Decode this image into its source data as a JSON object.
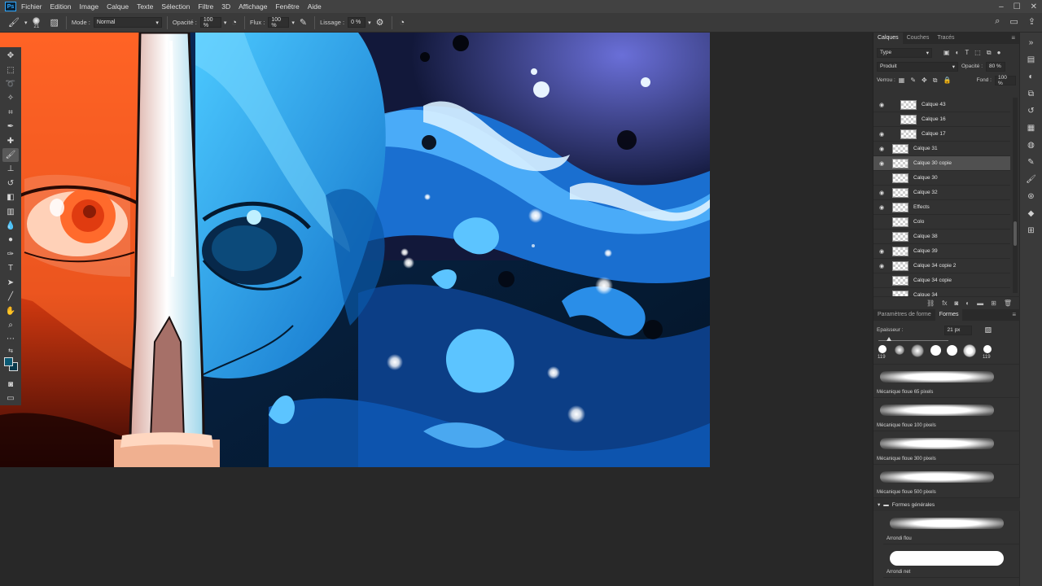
{
  "app": {
    "logo": "Ps"
  },
  "menubar": {
    "items": [
      "Fichier",
      "Edition",
      "Image",
      "Calque",
      "Texte",
      "Sélection",
      "Filtre",
      "3D",
      "Affichage",
      "Fenêtre",
      "Aide"
    ]
  },
  "options": {
    "brush_size": "21",
    "mode_label": "Mode :",
    "mode_value": "Normal",
    "opacity_label": "Opacité :",
    "opacity_value": "100 %",
    "flow_label": "Flux :",
    "flow_value": "100 %",
    "smoothing_label": "Lissage :",
    "smoothing_value": "0 %"
  },
  "layers_panel": {
    "tabs": [
      "Calques",
      "Couches",
      "Tracés"
    ],
    "filter_value": "Type",
    "blend_mode": "Produit",
    "opacity_label": "Opacité :",
    "opacity_value": "80 %",
    "lock_label": "Verrou :",
    "fill_label": "Fond :",
    "fill_value": "100 %",
    "layers": [
      {
        "name": "Calque 43",
        "visible": true,
        "indent": true,
        "selected": false
      },
      {
        "name": "Calque 16",
        "visible": false,
        "indent": true,
        "selected": false
      },
      {
        "name": "Calque 17",
        "visible": true,
        "indent": true,
        "selected": false
      },
      {
        "name": "Calque 31",
        "visible": true,
        "indent": false,
        "selected": false
      },
      {
        "name": "Calque 30 copie",
        "visible": true,
        "indent": false,
        "selected": true
      },
      {
        "name": "Calque 30",
        "visible": false,
        "indent": false,
        "selected": false
      },
      {
        "name": "Calque 32",
        "visible": true,
        "indent": false,
        "selected": false
      },
      {
        "name": "Effects",
        "visible": true,
        "indent": false,
        "selected": false
      },
      {
        "name": "Colo",
        "visible": false,
        "indent": false,
        "selected": false
      },
      {
        "name": "Calque 38",
        "visible": false,
        "indent": false,
        "selected": false
      },
      {
        "name": "Calque 39",
        "visible": true,
        "indent": false,
        "selected": false
      },
      {
        "name": "Calque 34 copie 2",
        "visible": true,
        "indent": false,
        "selected": false
      },
      {
        "name": "Calque 34 copie",
        "visible": false,
        "indent": false,
        "selected": false
      },
      {
        "name": "Calque 34",
        "visible": false,
        "indent": false,
        "selected": false
      }
    ]
  },
  "brush_panel": {
    "tabs": [
      "Paramètres de forme",
      "Formes"
    ],
    "thickness_label": "Epaisseur :",
    "thickness_value": "21 px",
    "preset_size_left": "119",
    "preset_size_right": "119",
    "brushes": [
      "Mécanique floue 65 pixels",
      "Mécanique floue 100 pixels",
      "Mécanique floue 300 pixels",
      "Mécanique floue 500 pixels"
    ],
    "folder": "Formes générales",
    "general_brushes": [
      "Arrondi flou",
      "Arrondi net"
    ]
  },
  "colors": {
    "foreground": "#0b5a74",
    "background": "#08394c",
    "accent": "#31a8ff"
  }
}
